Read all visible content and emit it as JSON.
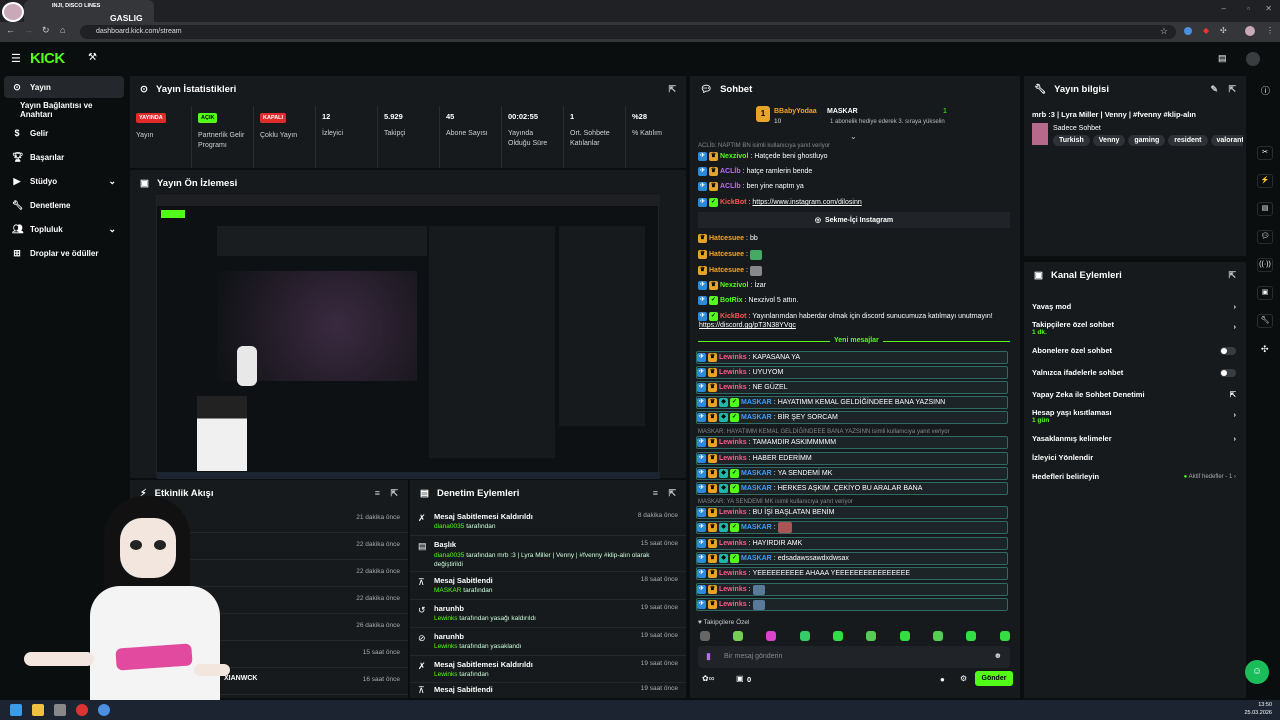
{
  "browser": {
    "tab_title_1": "INJI, DISCO LINES",
    "tab_title_2": "GASLIG",
    "url": "dashboard.kick.com/stream",
    "clock_time": "13:50",
    "clock_date": "25.03.2026"
  },
  "brand": {
    "logo": "KICK",
    "accent": "#53fc18"
  },
  "sidebar": {
    "items": [
      {
        "label": "Yayın",
        "icon": "broadcast-icon"
      },
      {
        "label": "Yayın Bağlantısı ve Anahtarı",
        "icon": ""
      },
      {
        "label": "Gelir",
        "icon": "dollar-icon"
      },
      {
        "label": "Başarılar",
        "icon": "trophy-icon"
      },
      {
        "label": "Stüdyo",
        "icon": "video-icon"
      },
      {
        "label": "Denetleme",
        "icon": "wrench-icon"
      },
      {
        "label": "Topluluk",
        "icon": "users-icon"
      },
      {
        "label": "Droplar ve ödüller",
        "icon": "gift-icon"
      }
    ]
  },
  "stats": {
    "title": "Yayın İstatistikleri",
    "items": [
      {
        "badge": "YAYINDA",
        "label": "Yayın"
      },
      {
        "badge": "AÇIK",
        "label": "Partnerlik Gelir Programı"
      },
      {
        "badge": "KAPALI",
        "label": "Çoklu Yayın"
      },
      {
        "value": "12",
        "label": "İzleyici"
      },
      {
        "value": "5.929",
        "label": "Takipçi"
      },
      {
        "value": "45",
        "label": "Abone Sayısı"
      },
      {
        "value": "00:02:55",
        "label": "Yayında Olduğu Süre"
      },
      {
        "value": "1",
        "label": "Ort. Sohbete Katılanlar"
      },
      {
        "value": "%28",
        "label": "% Katılım"
      }
    ]
  },
  "preview": {
    "title": "Yayın Ön İzlemesi"
  },
  "activity": {
    "title": "Etkinlik Akışı",
    "times": [
      "21 dakika önce",
      "22 dakika önce",
      "22 dakika önce",
      "22 dakika önce",
      "26 dakika önce",
      "15 saat önce",
      "16 saat önce"
    ],
    "last_user": "XIANWCK"
  },
  "moderation": {
    "title": "Denetim Eylemleri",
    "rows": [
      {
        "title": "Mesaj Sabitlemesi Kaldırıldı",
        "user": "diana0035",
        "suffix": "tarafından",
        "time": "8 dakika önce"
      },
      {
        "title": "Başlık",
        "user": "diana0035",
        "suffix": "tarafından mrb :3 | Lyra Miller | Venny | #fvenny #klip-alın olarak değiştirildi",
        "time": "15 saat önce"
      },
      {
        "title": "Mesaj Sabitlendi",
        "user": "MASKAR",
        "suffix": "tarafından",
        "time": "18 saat önce"
      },
      {
        "title": "harunhb",
        "user": "Lewinks",
        "suffix": "tarafından yasağı kaldırıldı",
        "time": "19 saat önce"
      },
      {
        "title": "harunhb",
        "user": "Lewinks",
        "suffix": "tarafından yasaklandı",
        "time": "19 saat önce"
      },
      {
        "title": "Mesaj Sabitlemesi Kaldırıldı",
        "user": "Lewinks",
        "suffix": "tarafından",
        "time": "19 saat önce"
      },
      {
        "title": "Mesaj Sabitlendi",
        "user": "",
        "suffix": "",
        "time": "19 saat önce"
      }
    ]
  },
  "chat": {
    "title": "Sohbet",
    "pinned_user": "BBabyYodaa",
    "pinned_count": "10",
    "pinned_gift_user": "MASKAR",
    "pinned_gift_count": "1",
    "pinned_gift_text": "1 abonelik hediye ederek 3. sıraya yükselin",
    "reply1": "ACLİb: NAPTIM BN isimli kullanıcıya yanıt veriyor",
    "lines_top": [
      {
        "user": "Nexzivol",
        "color": "#53fc18",
        "text": "Hatçede beni ghostluyo"
      },
      {
        "user": "ACLİb",
        "color": "#b86cff",
        "text": "hatçe ramlerin bende"
      },
      {
        "user": "ACLİb",
        "color": "#b86cff",
        "text": "ben yine naptm ya"
      },
      {
        "user": "KickBot",
        "color": "#ff5555",
        "text": "https://www.instagram.com/dilosinn"
      }
    ],
    "instagram_label": "Sekme-İçi Instagram",
    "lines_mid": [
      {
        "user": "Hatcesuee",
        "color": "#f5a623",
        "text": "bb"
      },
      {
        "user": "Hatcesuee",
        "color": "#f5a623",
        "text": ""
      },
      {
        "user": "Hatcesuee",
        "color": "#f5a623",
        "text": ""
      },
      {
        "user": "Nexzivol",
        "color": "#53fc18",
        "text": "İzar"
      },
      {
        "user": "BotRix",
        "color": "#53fc18",
        "text": "Nexzivol 5 attın."
      }
    ],
    "kickbot_msg": "Yayınlarımdan haberdar olmak için discord sunucumuza katılmayı unutmayın!",
    "kickbot_link": "https://discord.gg/pT3N38YVqc",
    "kickbot_user": "KickBot",
    "new_messages": "Yeni mesajlar",
    "new_lines": [
      {
        "user": "Lewinks",
        "text": "KAPASANA YA"
      },
      {
        "user": "Lewinks",
        "text": "UYUYOM"
      },
      {
        "user": "Lewinks",
        "text": "NE GÜZEL"
      },
      {
        "user": "MASKAR",
        "text": "HAYATIMM KEMAL GELDİĞİNDEEE BANA YAZSINN"
      },
      {
        "user": "MASKAR",
        "text": "BİR ŞEY SORCAM"
      }
    ],
    "reply2": "MASKAR: HAYATIMM KEMAL GELDİĞİNDEEE BANA YAZSINN isimli kullanıcıya yanıt veriyor",
    "new_lines2": [
      {
        "user": "Lewinks",
        "text": "TAMAMDIR ASKIMMMMM"
      },
      {
        "user": "Lewinks",
        "text": "HABER EDERİMM"
      },
      {
        "user": "MASKAR",
        "text": "YA SENDEMİ MK"
      },
      {
        "user": "MASKAR",
        "text": "HERKES AŞKIM .ÇEKİYO BU ARALAR BANA"
      }
    ],
    "reply3": "MASKAR: YA SENDEMİ MK isimli kullanıcıya yanıt veriyor",
    "new_lines3": [
      {
        "user": "Lewinks",
        "text": "BU İŞİ BAŞLATAN BENİM"
      },
      {
        "user": "MASKAR",
        "text": ""
      },
      {
        "user": "Lewinks",
        "text": "HAYIRDIR AMK"
      },
      {
        "user": "MASKAR",
        "text": "edsadawssawdxdwsax"
      },
      {
        "user": "Lewinks",
        "text": "YEEEEEEEEEE AHAAA YEEEEEEEEEEEEEEEE"
      },
      {
        "user": "Lewinks",
        "text": ""
      },
      {
        "user": "Lewinks",
        "text": ""
      }
    ],
    "followers_only": "Takipçilere Özel",
    "input_placeholder": "Bir mesaj gönderin",
    "bottom_count": "0",
    "send_label": "Gönder"
  },
  "stream_info": {
    "title": "Yayın bilgisi",
    "stream_title": "mrb :3 | Lyra Miller | Venny | #fvenny #klip-alın",
    "category": "Sadece Sohbet",
    "tags": [
      "Turkish",
      "Venny",
      "gaming",
      "resident",
      "valorant"
    ]
  },
  "channel_actions": {
    "title": "Kanal Eylemleri",
    "rows": [
      {
        "label": "Yavaş mod",
        "sub": "",
        "right": "chevron"
      },
      {
        "label": "Takipçilere özel sohbet",
        "sub": "1 dk.",
        "right": "chevron"
      },
      {
        "label": "Abonelere özel sohbet",
        "sub": "",
        "right": "toggle"
      },
      {
        "label": "Yalnızca ifadelerle sohbet",
        "sub": "",
        "right": "toggle"
      },
      {
        "label": "Yapay Zeka ile Sohbet Denetimi",
        "sub": "",
        "right": "external"
      },
      {
        "label": "Hesap yaşı kısıtlaması",
        "sub": "1 gün",
        "right": "chevron"
      },
      {
        "label": "Yasaklanmış kelimeler",
        "sub": "",
        "right": "chevron"
      },
      {
        "label": "İzleyici Yönlendir",
        "sub": "",
        "right": ""
      },
      {
        "label": "Hedefleri belirleyin",
        "sub": "",
        "right": "chevron",
        "status": "Aktif hedefler - 1"
      }
    ]
  }
}
